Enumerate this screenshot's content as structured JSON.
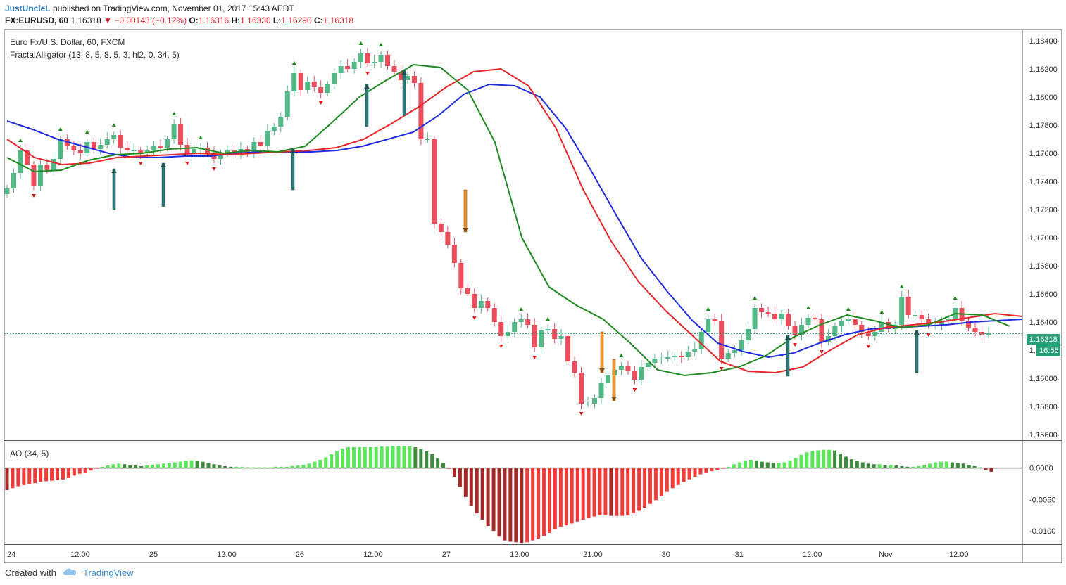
{
  "header": {
    "user": "JustUncleL",
    "published": "published on TradingView.com, November 01, 2017 15:43 AEDT",
    "symbol": "FX:EURUSD, 60",
    "last": "1.16318",
    "change": "▼ −0.00143 (−0.12%)",
    "o_label": "O:",
    "o_val": "1.16316",
    "h_label": "H:",
    "h_val": "1.16330",
    "l_label": "L:",
    "l_val": "1.16290",
    "c_label": "C:",
    "c_val": "1.16318"
  },
  "legend": {
    "instrument": "Euro Fx/U.S. Dollar, 60, FXCM",
    "indicator": "FractalAlligator (13, 8, 5, 8, 5, 3, hl2, 0, 34, 5)",
    "ao": "AO (34, 5)"
  },
  "price_badge": "1.16318",
  "time_badge": "16:55",
  "footer": {
    "created": "Created with",
    "brand": "TradingView"
  },
  "colors": {
    "up": "#53b987",
    "down": "#eb4d5c",
    "jaw": "#1f2de0",
    "teeth": "#e8262a",
    "lips": "#1f8a1f",
    "ao_up": "#5ce65c",
    "ao_up_dark": "#3d8c3d",
    "ao_down": "#f23b3b",
    "ao_down_dark": "#a52a2a",
    "signal_up": "#2b7a7a",
    "signal_down": "#f0922b"
  },
  "chart_data": [
    {
      "type": "candlestick",
      "title": "Euro Fx/U.S. Dollar, 60, FXCM",
      "ylim": [
        1.1556,
        1.1848
      ],
      "y_ticks": [
        "1.18400",
        "1.18200",
        "1.18000",
        "1.17800",
        "1.17600",
        "1.17400",
        "1.17200",
        "1.17000",
        "1.16800",
        "1.16600",
        "1.16400",
        "1.16200",
        "1.16000",
        "1.15800",
        "1.15600"
      ],
      "x_ticks": [
        "24",
        "12:00",
        "25",
        "12:00",
        "26",
        "12:00",
        "27",
        "12:00",
        "21:00",
        "30",
        "31",
        "12:00",
        "Nov",
        "12:00"
      ],
      "close_path": [
        1.1735,
        1.1746,
        1.1762,
        1.1752,
        1.1737,
        1.1752,
        1.1748,
        1.1756,
        1.177,
        1.1765,
        1.1762,
        1.176,
        1.1768,
        1.1763,
        1.1766,
        1.177,
        1.1773,
        1.1764,
        1.1762,
        1.1762,
        1.176,
        1.1762,
        1.1765,
        1.1764,
        1.177,
        1.1781,
        1.1766,
        1.176,
        1.1763,
        1.1764,
        1.176,
        1.1756,
        1.176,
        1.1762,
        1.176,
        1.1763,
        1.176,
        1.1768,
        1.1765,
        1.1776,
        1.1779,
        1.1786,
        1.1804,
        1.1817,
        1.1805,
        1.1811,
        1.1807,
        1.1803,
        1.1809,
        1.1817,
        1.1822,
        1.182,
        1.1825,
        1.1831,
        1.1824,
        1.1825,
        1.183,
        1.1822,
        1.1818,
        1.1812,
        1.1815,
        1.181,
        1.177,
        1.177,
        1.171,
        1.1704,
        1.1695,
        1.1682,
        1.1664,
        1.166,
        1.165,
        1.1655,
        1.165,
        1.164,
        1.163,
        1.1633,
        1.164,
        1.1642,
        1.1638,
        1.1622,
        1.1634,
        1.1635,
        1.1628,
        1.163,
        1.1612,
        1.1604,
        1.1582,
        1.1582,
        1.1586,
        1.1597,
        1.1602,
        1.1606,
        1.1609,
        1.1605,
        1.1599,
        1.1608,
        1.1611,
        1.1614,
        1.1614,
        1.1615,
        1.1616,
        1.1615,
        1.1619,
        1.1621,
        1.1633,
        1.1642,
        1.1641,
        1.1614,
        1.1618,
        1.162,
        1.1627,
        1.1635,
        1.165,
        1.1647,
        1.1646,
        1.1642,
        1.1646,
        1.1637,
        1.1631,
        1.1638,
        1.1643,
        1.1642,
        1.1626,
        1.163,
        1.1637,
        1.1641,
        1.1642,
        1.1638,
        1.1633,
        1.163,
        1.1633,
        1.164,
        1.1635,
        1.1638,
        1.1658,
        1.1645,
        1.1645,
        1.1642,
        1.1638,
        1.1638,
        1.1641,
        1.1642,
        1.165,
        1.1641,
        1.1636,
        1.1633,
        1.1631,
        1.16318
      ],
      "alligator": {
        "jaw_blue": [
          1.1783,
          1.1777,
          1.177,
          1.1765,
          1.176,
          1.1757,
          1.1757,
          1.1758,
          1.1758,
          1.176,
          1.1761,
          1.1761,
          1.1761,
          1.1762,
          1.1765,
          1.177,
          1.1775,
          1.1787,
          1.1802,
          1.1809,
          1.1808,
          1.18,
          1.1778,
          1.1748,
          1.1716,
          1.1685,
          1.1662,
          1.1641,
          1.1625,
          1.1619,
          1.1615,
          1.1618,
          1.1625,
          1.1631,
          1.1635,
          1.1636,
          1.1637,
          1.1638,
          1.164,
          1.1641,
          1.1642
        ],
        "teeth_red": [
          1.177,
          1.1757,
          1.1752,
          1.1753,
          1.1757,
          1.1758,
          1.1759,
          1.176,
          1.1759,
          1.176,
          1.1761,
          1.1762,
          1.1764,
          1.177,
          1.1781,
          1.1793,
          1.1807,
          1.1818,
          1.182,
          1.1808,
          1.1778,
          1.1734,
          1.1698,
          1.1669,
          1.1648,
          1.163,
          1.1612,
          1.1605,
          1.1604,
          1.1608,
          1.162,
          1.1631,
          1.1636,
          1.1638,
          1.164,
          1.1643,
          1.1646,
          1.1644
        ],
        "lips_green": [
          1.1757,
          1.1747,
          1.1748,
          1.1755,
          1.1759,
          1.176,
          1.1763,
          1.1764,
          1.176,
          1.1762,
          1.1761,
          1.1765,
          1.1782,
          1.18,
          1.1812,
          1.1823,
          1.1821,
          1.1805,
          1.1768,
          1.17,
          1.1665,
          1.1652,
          1.1642,
          1.1625,
          1.1606,
          1.1602,
          1.1604,
          1.1608,
          1.1616,
          1.1629,
          1.1638,
          1.1645,
          1.1641,
          1.1636,
          1.1638,
          1.1646,
          1.1645,
          1.1637
        ]
      },
      "current_price": 1.16318
    },
    {
      "type": "bar",
      "title": "AO (34, 5)",
      "ylim": [
        -0.0121,
        0.0042
      ],
      "y_ticks": [
        "0.0000",
        "-0.0050",
        "-0.0100"
      ],
      "values": [
        -0.0035,
        -0.0032,
        -0.0029,
        -0.0027,
        -0.0025,
        -0.0024,
        -0.0022,
        -0.0021,
        -0.002,
        -0.0019,
        -0.0018,
        -0.0016,
        -0.0012,
        -0.0009,
        -0.0007,
        -0.0004,
        -0.0001,
        0.0002,
        0.0004,
        0.0006,
        0.0007,
        0.0006,
        0.0005,
        0.0004,
        0.0003,
        0.0004,
        0.0005,
        0.0006,
        0.0007,
        0.0008,
        0.0009,
        0.001,
        0.0011,
        0.0012,
        0.0011,
        0.001,
        0.0008,
        0.0006,
        0.0004,
        0.0003,
        0.0002,
        0.0002,
        0.0002,
        0.0001,
        0.0001,
        0.0001,
        0.0001,
        0.0001,
        0.0002,
        0.0002,
        0.0002,
        0.0003,
        0.0004,
        0.0005,
        0.0007,
        0.001,
        0.0013,
        0.0017,
        0.0022,
        0.0027,
        0.0031,
        0.0033,
        0.0033,
        0.0033,
        0.0033,
        0.0033,
        0.0033,
        0.0034,
        0.0034,
        0.0035,
        0.0035,
        0.0035,
        0.0035,
        0.0033,
        0.0031,
        0.0027,
        0.0022,
        0.0015,
        0.0008,
        -0.0001,
        -0.0014,
        -0.003,
        -0.0046,
        -0.006,
        -0.0072,
        -0.0082,
        -0.0092,
        -0.01,
        -0.0109,
        -0.0115,
        -0.0117,
        -0.0118,
        -0.0119,
        -0.0118,
        -0.0115,
        -0.0112,
        -0.0108,
        -0.0103,
        -0.0097,
        -0.0093,
        -0.0091,
        -0.0088,
        -0.0085,
        -0.0082,
        -0.0079,
        -0.0077,
        -0.0075,
        -0.0075,
        -0.0076,
        -0.0076,
        -0.0076,
        -0.0075,
        -0.0072,
        -0.0068,
        -0.0063,
        -0.0057,
        -0.0051,
        -0.0045,
        -0.0038,
        -0.0032,
        -0.0027,
        -0.0022,
        -0.0018,
        -0.0014,
        -0.001,
        -0.0007,
        -0.0005,
        -0.0003,
        -0.0001,
        0.0002,
        0.0006,
        0.0009,
        0.0012,
        0.0013,
        0.0012,
        0.001,
        0.0009,
        0.0008,
        0.0008,
        0.0009,
        0.0012,
        0.0016,
        0.0021,
        0.0025,
        0.0027,
        0.0028,
        0.0029,
        0.0029,
        0.0028,
        0.0023,
        0.0018,
        0.0014,
        0.0011,
        0.0009,
        0.0007,
        0.0006,
        0.0006,
        0.0005,
        0.0005,
        0.0004,
        0.0003,
        0.0002,
        0.0002,
        0.0003,
        0.0005,
        0.0007,
        0.0009,
        0.001,
        0.001,
        0.0009,
        0.0008,
        0.0007,
        0.0005,
        0.0003,
        0.0001,
        -0.0003,
        -0.0006
      ]
    }
  ]
}
